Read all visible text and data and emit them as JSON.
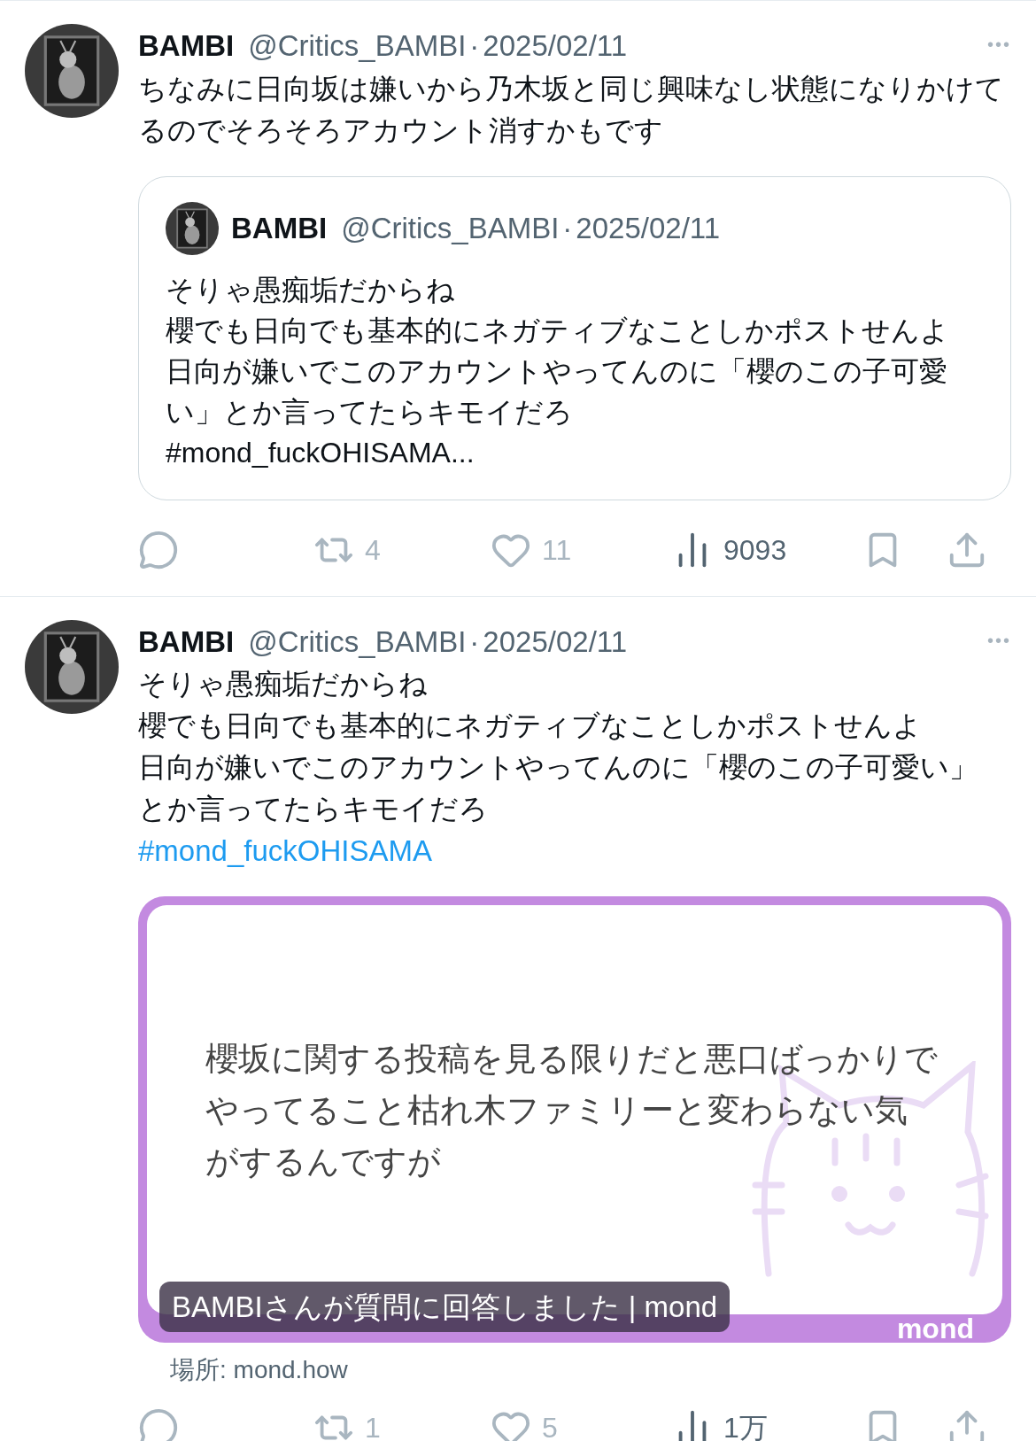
{
  "tweets": [
    {
      "name": "BAMBI",
      "handle": "@Critics_BAMBI",
      "separator": "·",
      "date": "2025/02/11",
      "more": "•••",
      "body": [
        "ちなみに日向坂は嫌いから乃木坂と同じ興味なし状態になりかけてるのでそろそろアカウント消すかもです"
      ],
      "quote": {
        "name": "BAMBI",
        "handle": "@Critics_BAMBI",
        "separator": "·",
        "date": "2025/02/11",
        "body": [
          "そりゃ愚痴垢だからね",
          "櫻でも日向でも基本的にネガティブなことしかポストせんよ",
          "日向が嫌いでこのアカウントやってんのに「櫻のこの子可愛い」とか言ってたらキモイだろ",
          "#mond_fuckOHISAMA..."
        ]
      },
      "actions": [
        {
          "kind": "reply",
          "dimmed": true
        },
        {
          "kind": "repost",
          "count": "4",
          "dimmed": true
        },
        {
          "kind": "like",
          "count": "11",
          "dimmed": true
        },
        {
          "kind": "views",
          "count": "9093",
          "dimmed": false
        },
        {
          "kind": "bookmark",
          "dimmed": true
        },
        {
          "kind": "share",
          "dimmed": true
        }
      ]
    },
    {
      "name": "BAMBI",
      "handle": "@Critics_BAMBI",
      "separator": "·",
      "date": "2025/02/11",
      "more": "•••",
      "body": [
        "そりゃ愚痴垢だからね",
        "櫻でも日向でも基本的にネガティブなことしかポストせんよ",
        "日向が嫌いでこのアカウントやってんのに「櫻のこの子可愛い」とか言ってたらキモイだろ"
      ],
      "hashtag": "#mond_fuckOHISAMA",
      "card": {
        "question": "櫻坂に関する投稿を見る限りだと悪口ばっかりでやってること枯れ木ファミリーと変わらない気がするんですが",
        "logo": "mond",
        "caption": "BAMBIさんが質問に回答しました | mond",
        "source": "場所: mond.how"
      },
      "actions": [
        {
          "kind": "reply",
          "dimmed": true
        },
        {
          "kind": "repost",
          "count": "1",
          "dimmed": true
        },
        {
          "kind": "like",
          "count": "5",
          "dimmed": true
        },
        {
          "kind": "views",
          "count": "1万",
          "dimmed": false
        },
        {
          "kind": "bookmark",
          "dimmed": true
        },
        {
          "kind": "share",
          "dimmed": true
        }
      ]
    }
  ]
}
